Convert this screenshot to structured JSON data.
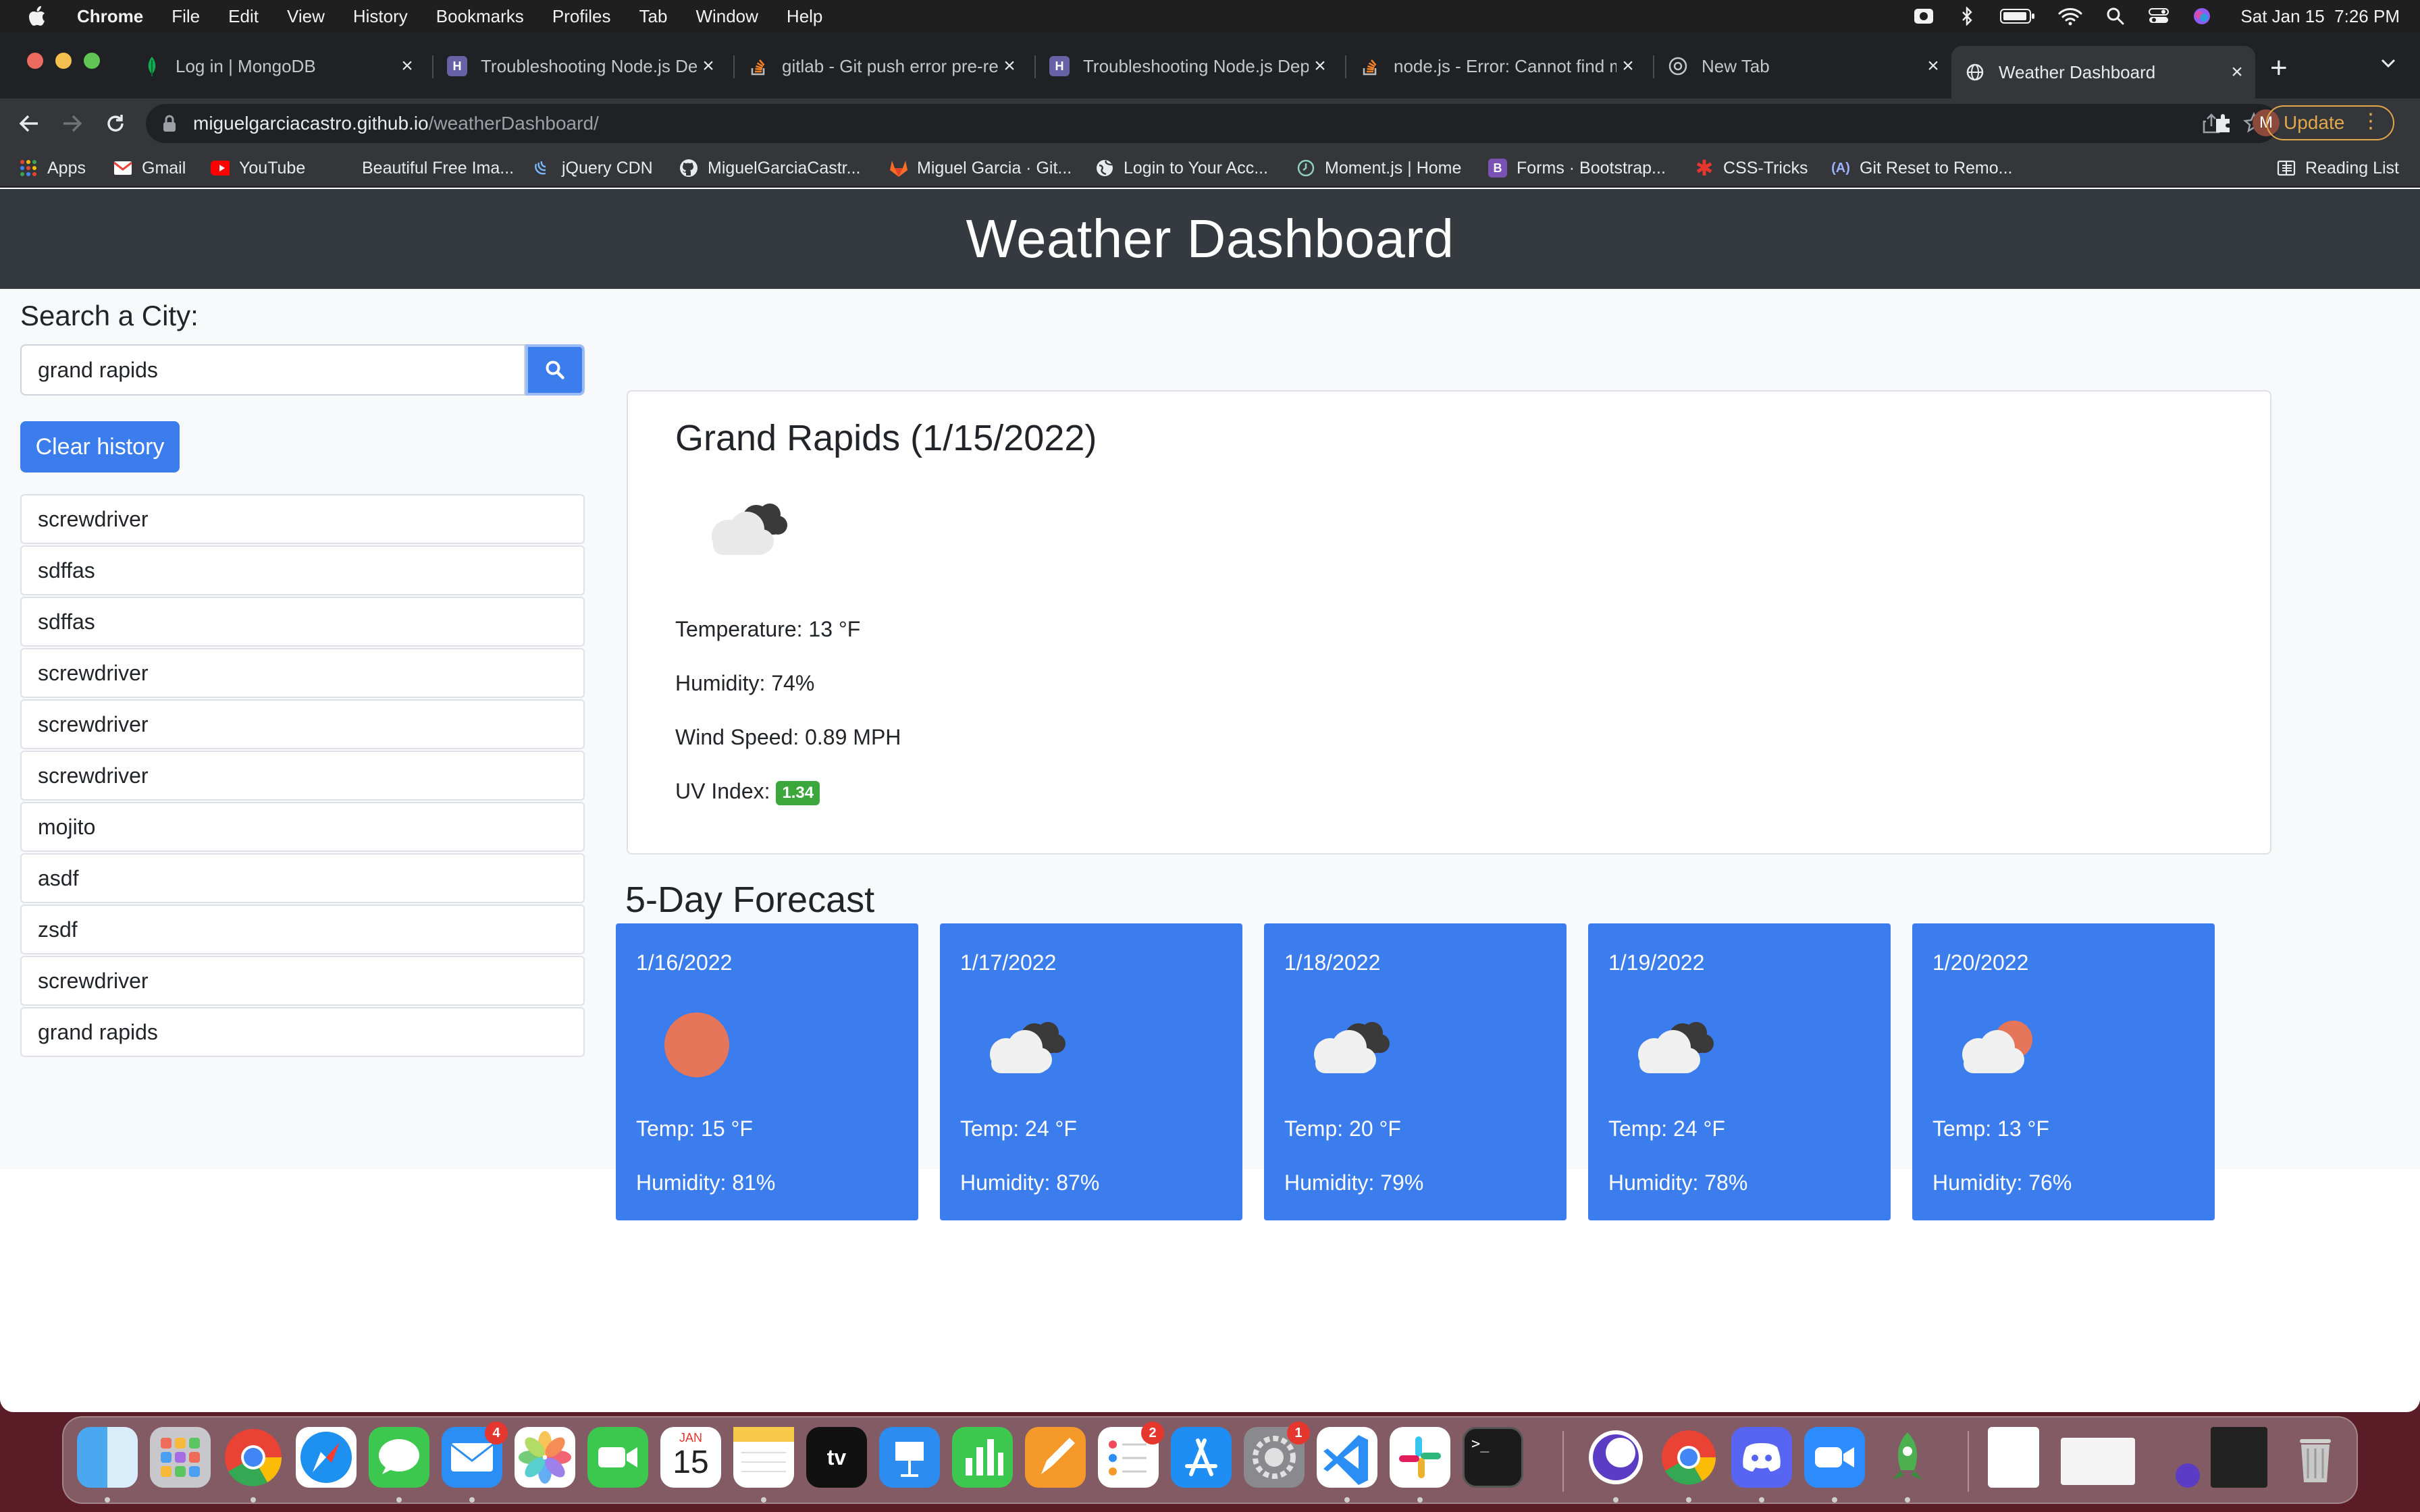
{
  "menubar": {
    "app": "Chrome",
    "items": [
      "File",
      "Edit",
      "View",
      "History",
      "Bookmarks",
      "Profiles",
      "Tab",
      "Window",
      "Help"
    ],
    "clock": "Sat Jan 15  7:26 PM"
  },
  "browser": {
    "tabs": [
      {
        "title": "Log in | MongoDB",
        "icon": "leaf-icon"
      },
      {
        "title": "Troubleshooting Node.js Dep",
        "icon": "heroku-icon"
      },
      {
        "title": "gitlab - Git push error pre-re",
        "icon": "stackoverflow-icon"
      },
      {
        "title": "Troubleshooting Node.js Dep",
        "icon": "heroku-icon"
      },
      {
        "title": "node.js - Error: Cannot find m",
        "icon": "stackoverflow-icon"
      },
      {
        "title": "New Tab",
        "icon": "chrome-icon"
      },
      {
        "title": "Weather Dashboard",
        "icon": "globe-icon"
      }
    ],
    "url_host": "miguelgarciacastro.github.io",
    "url_path": "/weatherDashboard/",
    "profile_initial": "M",
    "update_label": "Update",
    "bookmarks": [
      {
        "label": "Apps"
      },
      {
        "label": "Gmail"
      },
      {
        "label": "YouTube"
      },
      {
        "label": "Beautiful Free Ima..."
      },
      {
        "label": "jQuery CDN"
      },
      {
        "label": "MiguelGarciaCastr..."
      },
      {
        "label": "Miguel Garcia · Git..."
      },
      {
        "label": "Login to Your Acc..."
      },
      {
        "label": "Moment.js | Home"
      },
      {
        "label": "Forms · Bootstrap..."
      },
      {
        "label": "CSS-Tricks"
      },
      {
        "label": "Git Reset to Remo..."
      }
    ],
    "reading_list": "Reading List"
  },
  "page": {
    "header_title": "Weather Dashboard",
    "search_label": "Search a City:",
    "search_value": "grand rapids",
    "clear_label": "Clear history",
    "history": [
      "screwdriver",
      "sdffas",
      "sdffas",
      "screwdriver",
      "screwdriver",
      "screwdriver",
      "mojito",
      "asdf",
      "zsdf",
      "screwdriver",
      "grand rapids"
    ],
    "current": {
      "title": "Grand Rapids (1/15/2022)",
      "icon": "cloudy-icon",
      "temperature": "Temperature: 13 °F",
      "humidity": "Humidity: 74%",
      "wind": "Wind Speed: 0.89 MPH",
      "uv_label": "UV Index:",
      "uv_value": "1.34",
      "uv_color": "#3ba63b"
    },
    "forecast_title": "5-Day Forecast",
    "forecast": [
      {
        "date": "1/16/2022",
        "icon": "sun-icon",
        "temp": "Temp: 15 °F",
        "humidity": "Humidity: 81%"
      },
      {
        "date": "1/17/2022",
        "icon": "cloudy-icon",
        "temp": "Temp: 24 °F",
        "humidity": "Humidity: 87%"
      },
      {
        "date": "1/18/2022",
        "icon": "cloudy-icon",
        "temp": "Temp: 20 °F",
        "humidity": "Humidity: 79%"
      },
      {
        "date": "1/19/2022",
        "icon": "cloudy-icon",
        "temp": "Temp: 24 °F",
        "humidity": "Humidity: 78%"
      },
      {
        "date": "1/20/2022",
        "icon": "partly-cloudy-icon",
        "temp": "Temp: 13 °F",
        "humidity": "Humidity: 76%"
      }
    ],
    "accent": "#3b7ded",
    "header_bg": "#343a40"
  },
  "dock": {
    "calendar_month": "JAN",
    "calendar_day": "15",
    "mail_badge": "4",
    "reminders_badge": "2",
    "settings_badge": "1"
  }
}
